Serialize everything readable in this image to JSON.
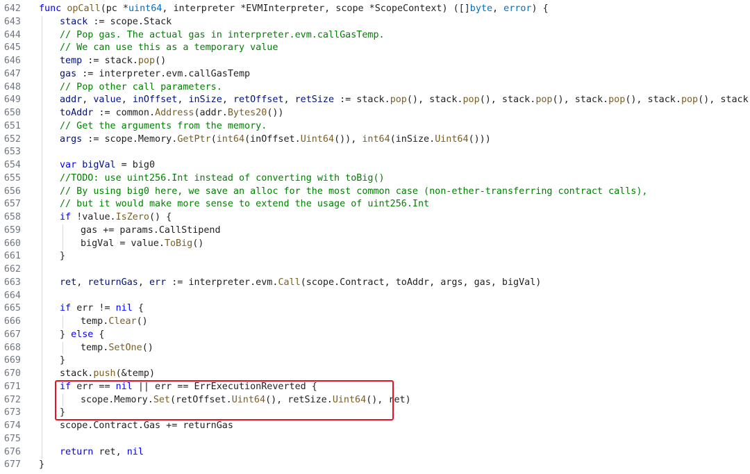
{
  "editor": {
    "highlight_color": "#e81123",
    "colors": {
      "keyword": "#0000ff",
      "function": "#795e26",
      "type": "#0070c1",
      "variable": "#001080",
      "comment": "#008000",
      "text": "#1f1f1f",
      "line_number": "#6e7681"
    },
    "lines": [
      {
        "n": "642",
        "indent": 0,
        "tokens": [
          [
            "kw",
            "func "
          ],
          [
            "fn",
            "opCall"
          ],
          [
            "txt",
            "(pc *"
          ],
          [
            "ty",
            "uint64"
          ],
          [
            "txt",
            ", interpreter *EVMInterpreter, scope *ScopeContext) ([]"
          ],
          [
            "ty",
            "byte"
          ],
          [
            "txt",
            ", "
          ],
          [
            "ty",
            "error"
          ],
          [
            "txt",
            ") {"
          ]
        ]
      },
      {
        "n": "643",
        "indent": 1,
        "tokens": [
          [
            "var",
            "stack"
          ],
          [
            "txt",
            " := scope.Stack"
          ]
        ]
      },
      {
        "n": "644",
        "indent": 1,
        "tokens": [
          [
            "com",
            "// Pop gas. The actual gas in interpreter.evm.callGasTemp."
          ]
        ]
      },
      {
        "n": "645",
        "indent": 1,
        "tokens": [
          [
            "com",
            "// We can use this as a temporary value"
          ]
        ]
      },
      {
        "n": "646",
        "indent": 1,
        "tokens": [
          [
            "var",
            "temp"
          ],
          [
            "txt",
            " := stack."
          ],
          [
            "fn",
            "pop"
          ],
          [
            "txt",
            "()"
          ]
        ]
      },
      {
        "n": "647",
        "indent": 1,
        "tokens": [
          [
            "var",
            "gas"
          ],
          [
            "txt",
            " := interpreter.evm.callGasTemp"
          ]
        ]
      },
      {
        "n": "648",
        "indent": 1,
        "tokens": [
          [
            "com",
            "// Pop other call parameters."
          ]
        ]
      },
      {
        "n": "649",
        "indent": 1,
        "tokens": [
          [
            "var",
            "addr"
          ],
          [
            "txt",
            ", "
          ],
          [
            "var",
            "value"
          ],
          [
            "txt",
            ", "
          ],
          [
            "var",
            "inOffset"
          ],
          [
            "txt",
            ", "
          ],
          [
            "var",
            "inSize"
          ],
          [
            "txt",
            ", "
          ],
          [
            "var",
            "retOffset"
          ],
          [
            "txt",
            ", "
          ],
          [
            "var",
            "retSize"
          ],
          [
            "txt",
            " := stack."
          ],
          [
            "fn",
            "pop"
          ],
          [
            "txt",
            "(), stack."
          ],
          [
            "fn",
            "pop"
          ],
          [
            "txt",
            "(), stack."
          ],
          [
            "fn",
            "pop"
          ],
          [
            "txt",
            "(), stack."
          ],
          [
            "fn",
            "pop"
          ],
          [
            "txt",
            "(), stack."
          ],
          [
            "fn",
            "pop"
          ],
          [
            "txt",
            "(), stack."
          ],
          [
            "fn",
            "pop"
          ],
          [
            "txt",
            "()"
          ]
        ]
      },
      {
        "n": "650",
        "indent": 1,
        "tokens": [
          [
            "var",
            "toAddr"
          ],
          [
            "txt",
            " := common."
          ],
          [
            "fn",
            "Address"
          ],
          [
            "txt",
            "(addr."
          ],
          [
            "fn",
            "Bytes20"
          ],
          [
            "txt",
            "())"
          ]
        ]
      },
      {
        "n": "651",
        "indent": 1,
        "tokens": [
          [
            "com",
            "// Get the arguments from the memory."
          ]
        ]
      },
      {
        "n": "652",
        "indent": 1,
        "tokens": [
          [
            "var",
            "args"
          ],
          [
            "txt",
            " := scope.Memory."
          ],
          [
            "fn",
            "GetPtr"
          ],
          [
            "txt",
            "("
          ],
          [
            "fn",
            "int64"
          ],
          [
            "txt",
            "(inOffset."
          ],
          [
            "fn",
            "Uint64"
          ],
          [
            "txt",
            "()), "
          ],
          [
            "fn",
            "int64"
          ],
          [
            "txt",
            "(inSize."
          ],
          [
            "fn",
            "Uint64"
          ],
          [
            "txt",
            "()))"
          ]
        ]
      },
      {
        "n": "653",
        "indent": 1,
        "tokens": []
      },
      {
        "n": "654",
        "indent": 1,
        "tokens": [
          [
            "kw",
            "var "
          ],
          [
            "var",
            "bigVal"
          ],
          [
            "txt",
            " = big0"
          ]
        ]
      },
      {
        "n": "655",
        "indent": 1,
        "tokens": [
          [
            "com",
            "//TODO: use uint256.Int instead of converting with toBig()"
          ]
        ]
      },
      {
        "n": "656",
        "indent": 1,
        "tokens": [
          [
            "com",
            "// By using big0 here, we save an alloc for the most common case (non-ether-transferring contract calls),"
          ]
        ]
      },
      {
        "n": "657",
        "indent": 1,
        "tokens": [
          [
            "com",
            "// but it would make more sense to extend the usage of uint256.Int"
          ]
        ]
      },
      {
        "n": "658",
        "indent": 1,
        "tokens": [
          [
            "kw",
            "if "
          ],
          [
            "txt",
            "!value."
          ],
          [
            "fn",
            "IsZero"
          ],
          [
            "txt",
            "() {"
          ]
        ]
      },
      {
        "n": "659",
        "indent": 2,
        "tokens": [
          [
            "txt",
            "gas += params.CallStipend"
          ]
        ]
      },
      {
        "n": "660",
        "indent": 2,
        "tokens": [
          [
            "txt",
            "bigVal = value."
          ],
          [
            "fn",
            "ToBig"
          ],
          [
            "txt",
            "()"
          ]
        ]
      },
      {
        "n": "661",
        "indent": 1,
        "tokens": [
          [
            "txt",
            "}"
          ]
        ]
      },
      {
        "n": "662",
        "indent": 1,
        "tokens": []
      },
      {
        "n": "663",
        "indent": 1,
        "tokens": [
          [
            "var",
            "ret"
          ],
          [
            "txt",
            ", "
          ],
          [
            "var",
            "returnGas"
          ],
          [
            "txt",
            ", "
          ],
          [
            "var",
            "err"
          ],
          [
            "txt",
            " := interpreter.evm."
          ],
          [
            "fn",
            "Call"
          ],
          [
            "txt",
            "(scope.Contract, toAddr, args, gas, bigVal)"
          ]
        ]
      },
      {
        "n": "664",
        "indent": 1,
        "tokens": []
      },
      {
        "n": "665",
        "indent": 1,
        "tokens": [
          [
            "kw",
            "if "
          ],
          [
            "txt",
            "err != "
          ],
          [
            "kw",
            "nil"
          ],
          [
            "txt",
            " {"
          ]
        ]
      },
      {
        "n": "666",
        "indent": 2,
        "tokens": [
          [
            "txt",
            "temp."
          ],
          [
            "fn",
            "Clear"
          ],
          [
            "txt",
            "()"
          ]
        ]
      },
      {
        "n": "667",
        "indent": 1,
        "tokens": [
          [
            "txt",
            "} "
          ],
          [
            "kw",
            "else"
          ],
          [
            "txt",
            " {"
          ]
        ]
      },
      {
        "n": "668",
        "indent": 2,
        "tokens": [
          [
            "txt",
            "temp."
          ],
          [
            "fn",
            "SetOne"
          ],
          [
            "txt",
            "()"
          ]
        ]
      },
      {
        "n": "669",
        "indent": 1,
        "tokens": [
          [
            "txt",
            "}"
          ]
        ]
      },
      {
        "n": "670",
        "indent": 1,
        "tokens": [
          [
            "txt",
            "stack."
          ],
          [
            "fn",
            "push"
          ],
          [
            "txt",
            "(&temp)"
          ]
        ]
      },
      {
        "n": "671",
        "indent": 1,
        "tokens": [
          [
            "kw",
            "if "
          ],
          [
            "txt",
            "err == "
          ],
          [
            "kw",
            "nil"
          ],
          [
            "txt",
            " || err == ErrExecutionReverted {"
          ]
        ]
      },
      {
        "n": "672",
        "indent": 2,
        "tokens": [
          [
            "txt",
            "scope.Memory."
          ],
          [
            "fn",
            "Set"
          ],
          [
            "txt",
            "(retOffset."
          ],
          [
            "fn",
            "Uint64"
          ],
          [
            "txt",
            "(), retSize."
          ],
          [
            "fn",
            "Uint64"
          ],
          [
            "txt",
            "(), ret)"
          ]
        ]
      },
      {
        "n": "673",
        "indent": 1,
        "tokens": [
          [
            "txt",
            "}"
          ]
        ]
      },
      {
        "n": "674",
        "indent": 1,
        "tokens": [
          [
            "txt",
            "scope.Contract.Gas += returnGas"
          ]
        ]
      },
      {
        "n": "675",
        "indent": 1,
        "tokens": []
      },
      {
        "n": "676",
        "indent": 1,
        "tokens": [
          [
            "kw",
            "return "
          ],
          [
            "txt",
            "ret, "
          ],
          [
            "kw",
            "nil"
          ]
        ]
      },
      {
        "n": "677",
        "indent": 0,
        "tokens": [
          [
            "txt",
            "}"
          ]
        ]
      }
    ]
  }
}
